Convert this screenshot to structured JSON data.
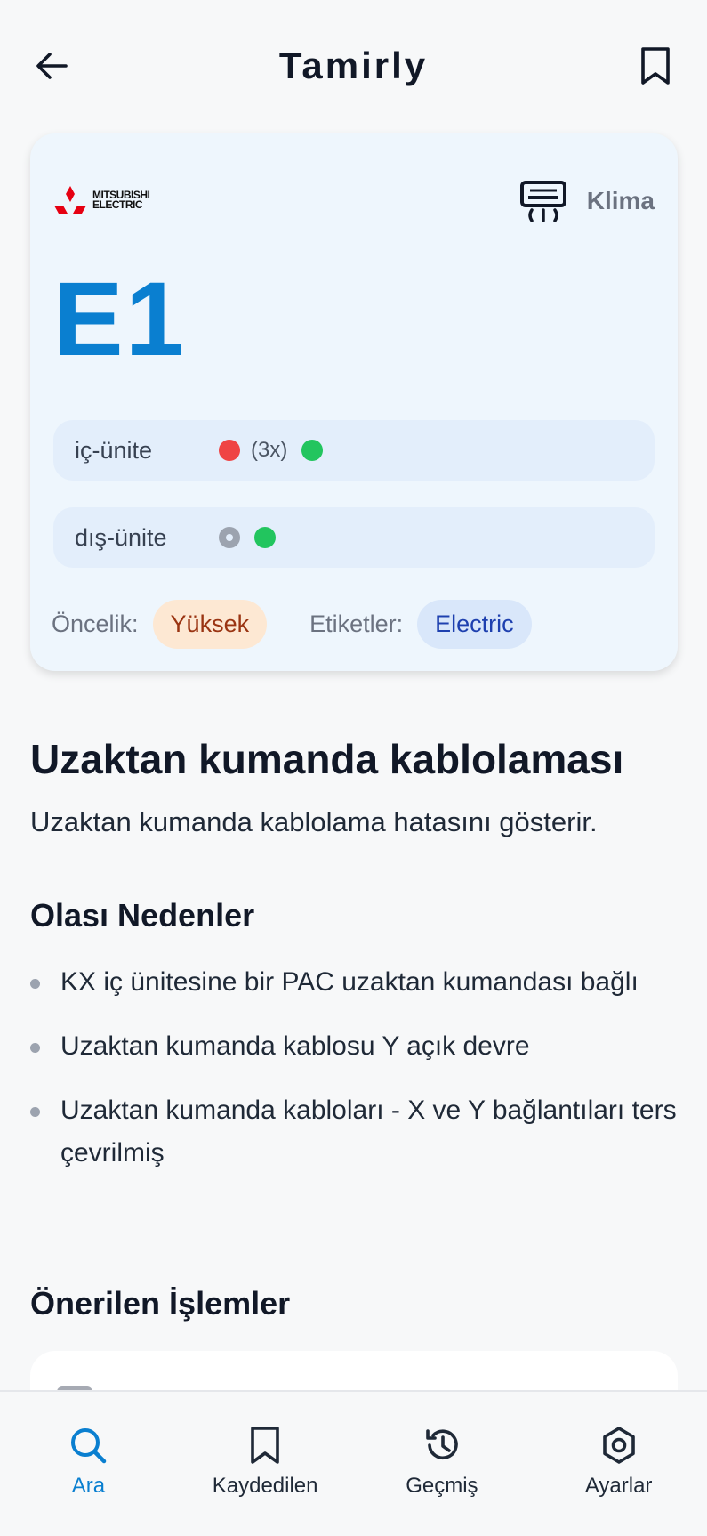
{
  "header": {
    "title": "Tamirly"
  },
  "card": {
    "brand": {
      "line1": "MITSUBISHI",
      "line2": "ELECTRIC"
    },
    "category": "Klima",
    "code": "E1",
    "indoor": {
      "label": "iç-ünite",
      "blink": "(3x)"
    },
    "outdoor": {
      "label": "dış-ünite"
    },
    "priority_label": "Öncelik:",
    "priority_value": "Yüksek",
    "tags_label": "Etiketler:",
    "tag_value": "Electric"
  },
  "error": {
    "title": "Uzaktan kumanda kablolaması",
    "description": "Uzaktan kumanda kablolama hatasını gösterir."
  },
  "causes": {
    "title": "Olası Nedenler",
    "items": [
      "KX iç ünitesine bir PAC uzaktan kumandası bağlı",
      "Uzaktan kumanda kablosu Y açık devre",
      "Uzaktan kumanda kabloları - X ve Y bağlantıları ters çevrilmiş"
    ]
  },
  "actions": {
    "title": "Önerilen İşlemler"
  },
  "nav": {
    "search": "Ara",
    "saved": "Kaydedilen",
    "history": "Geçmiş",
    "settings": "Ayarlar"
  },
  "colors": {
    "accent": "#0a7fd0",
    "red_led": "#ef4444",
    "green_led": "#22c55e"
  }
}
